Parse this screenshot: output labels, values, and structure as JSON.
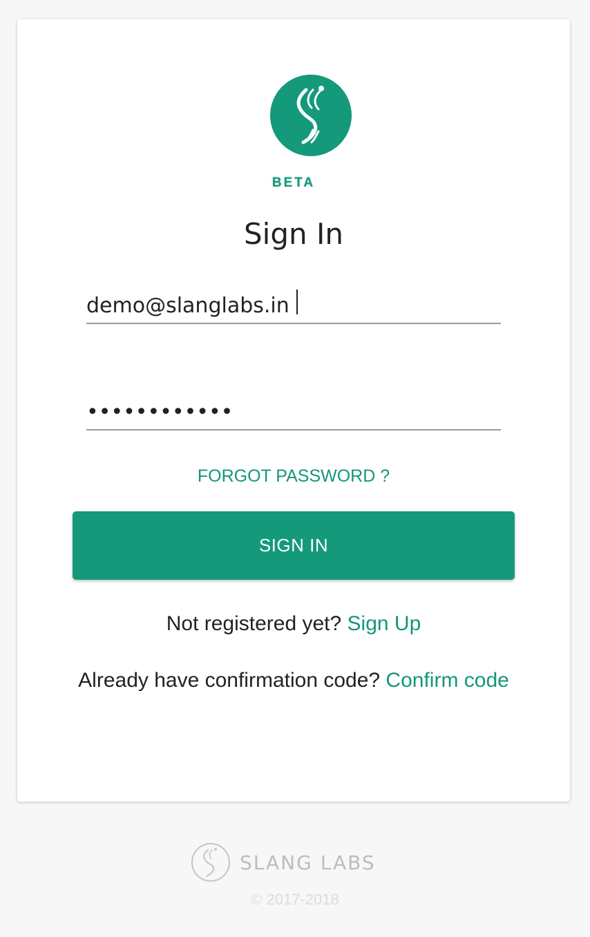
{
  "brand": {
    "logo_icon": "slang-s-logo-icon",
    "badge": "BETA",
    "accent_color": "#14997b"
  },
  "form": {
    "title": "Sign In",
    "email_value": "demo@slanglabs.in",
    "password_value": "demo12345678",
    "forgot_label": "FORGOT PASSWORD ?",
    "submit_label": "SIGN IN"
  },
  "signup_prompt": {
    "text": "Not registered yet? ",
    "link": "Sign Up"
  },
  "confirm_prompt": {
    "text": "Already have confirmation code? ",
    "link": "Confirm code"
  },
  "footer": {
    "company": "SLANG LABS",
    "copyright": "© 2017-2018"
  }
}
